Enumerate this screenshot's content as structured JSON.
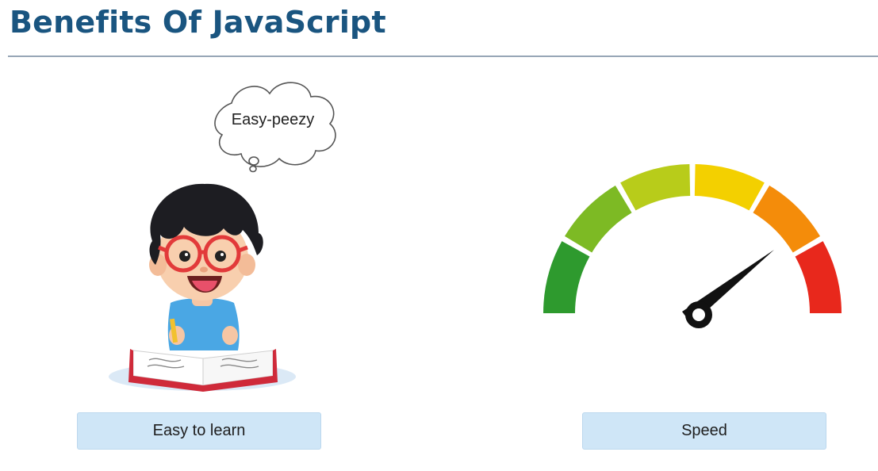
{
  "slide": {
    "title": "Benefits Of JavaScript"
  },
  "benefits": [
    {
      "label": "Easy to learn",
      "thought_bubble": "Easy-peezy"
    },
    {
      "label": "Speed"
    }
  ],
  "colors": {
    "title": "#1a5580",
    "label_bg": "#cfe6f7",
    "gauge": [
      "#2e9a2e",
      "#7dba24",
      "#b8cc1a",
      "#f3d000",
      "#f48c0a",
      "#e8281c"
    ]
  }
}
